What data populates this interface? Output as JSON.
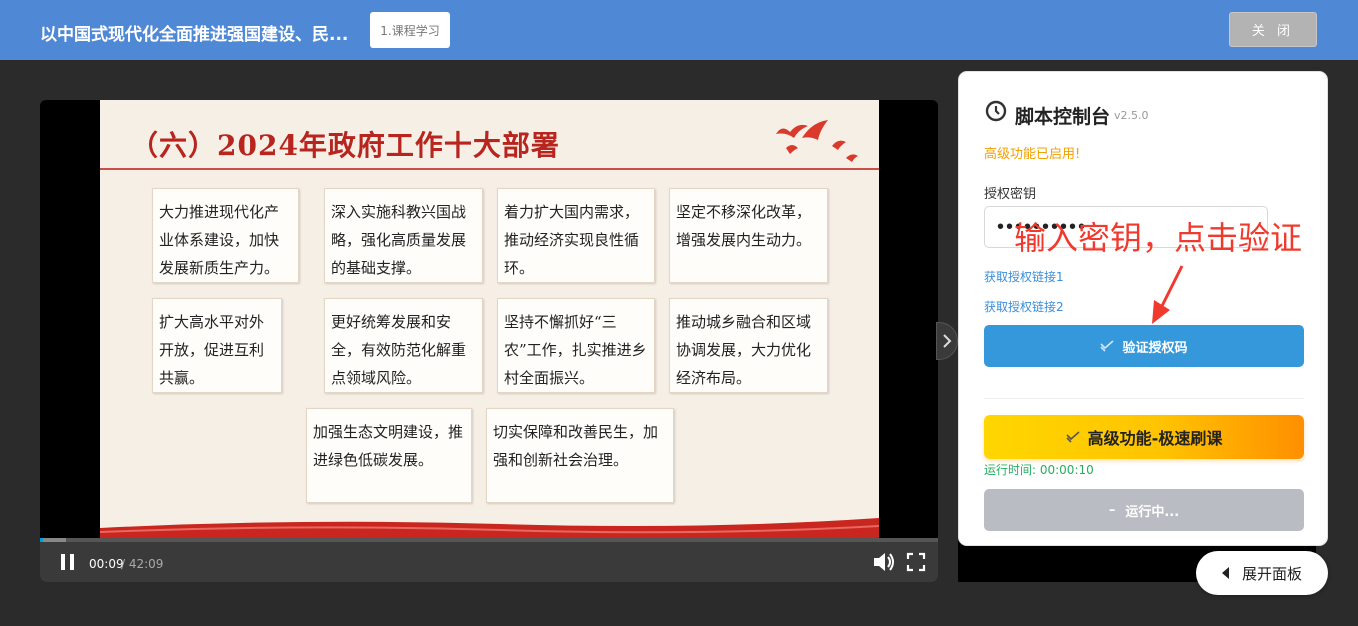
{
  "header": {
    "course_title": "以中国式现代化全面推进强国建设、民...",
    "tab_label": "1.课程学习",
    "close_label": "关 闭"
  },
  "video": {
    "slide": {
      "title": "（六）2024年政府工作十大部署",
      "cards": [
        "大力推进现代化产业体系建设，加快发展新质生产力。",
        "深入实施科教兴国战略，强化高质量发展的基础支撑。",
        "着力扩大国内需求，推动经济实现良性循环。",
        "坚定不移深化改革，增强发展内生动力。",
        "扩大高水平对外开放，促进互利共赢。",
        "更好统筹发展和安全，有效防范化解重点领域风险。",
        "坚持不懈抓好“三农”工作，扎实推进乡村全面振兴。",
        "推动城乡融合和区域协调发展，大力优化经济布局。",
        "加强生态文明建设，推进绿色低碳发展。",
        "切实保障和改善民生，加强和创新社会治理。"
      ]
    },
    "current_time": "00:09",
    "time_sep": "/ 42:09",
    "progress": 0.0036
  },
  "panel": {
    "title": "脚本控制台",
    "version": "v2.5.0",
    "advanced_note": "高级功能已启用!",
    "key_label": "授权密钥",
    "key_value": "••••••••••",
    "link1": "获取授权链接1",
    "link2": "获取授权链接2",
    "verify_label": "验证授权码",
    "fast_label": "高级功能-极速刷课",
    "run_time": "运行时间: 00:00:10",
    "running_label": "运行中..."
  },
  "annotation": {
    "text": "输入密钥，点击验证"
  },
  "expand_label": "展开面板",
  "colors": {
    "header_bg": "#4f88d4",
    "verify_blue": "#3498db",
    "fast_gradient_start": "#ffd600",
    "fast_gradient_end": "#ff8f00",
    "annotation_red": "#f03a2e",
    "slide_title_red": "#b8251f",
    "advanced_note": "#f0a000",
    "run_time_green": "#27ae60"
  }
}
